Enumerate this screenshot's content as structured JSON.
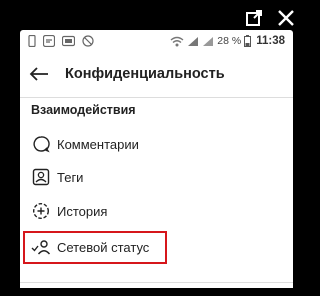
{
  "window_controls": {
    "open_external_icon": "open-external-icon",
    "close_icon": "close-icon"
  },
  "status_bar": {
    "battery_percent": "28 %",
    "time": "11:38"
  },
  "header": {
    "title": "Конфиденциальность"
  },
  "section": {
    "title": "Взаимодействия",
    "items": [
      {
        "label": "Комментарии",
        "icon": "comment-icon"
      },
      {
        "label": "Теги",
        "icon": "tag-person-icon"
      },
      {
        "label": "История",
        "icon": "story-add-icon"
      },
      {
        "label": "Сетевой статус",
        "icon": "activity-status-icon"
      }
    ]
  },
  "colors": {
    "highlight": "#d6161b",
    "background": "#ffffff",
    "frame": "#000000"
  }
}
